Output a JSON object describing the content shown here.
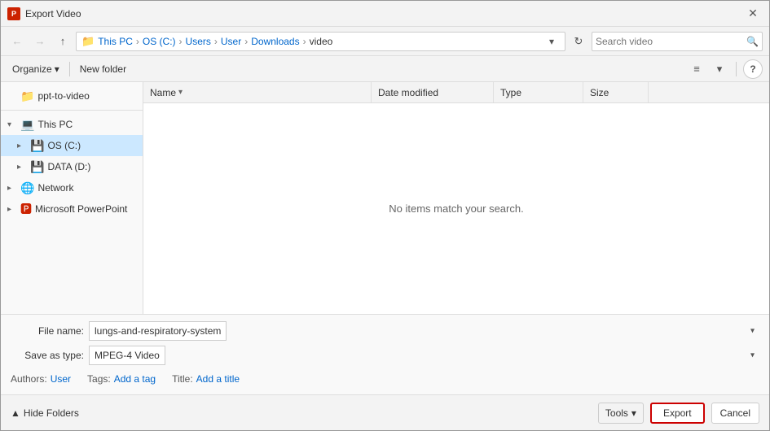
{
  "titleBar": {
    "title": "Export Video",
    "closeLabel": "✕"
  },
  "navBar": {
    "backBtn": "←",
    "forwardBtn": "→",
    "upBtn": "↑",
    "breadcrumb": {
      "folderIcon": "📁",
      "items": [
        "This PC",
        "OS (C:)",
        "Users",
        "User",
        "Downloads",
        "video"
      ]
    },
    "refreshBtn": "↻",
    "searchPlaceholder": "Search video",
    "searchIcon": "🔍"
  },
  "toolbar": {
    "organizeLabel": "Organize",
    "newFolderLabel": "New folder",
    "viewIcon": "≡",
    "viewDropIcon": "▾",
    "helpLabel": "?"
  },
  "sidebar": {
    "items": [
      {
        "id": "ppt-to-video",
        "label": "ppt-to-video",
        "icon": "📁",
        "indent": 0,
        "chevron": ""
      },
      {
        "id": "separator",
        "label": "",
        "icon": "",
        "indent": 0,
        "chevron": ""
      },
      {
        "id": "this-pc",
        "label": "This PC",
        "icon": "💻",
        "indent": 0,
        "chevron": "▾",
        "expanded": true
      },
      {
        "id": "os-c",
        "label": "OS (C:)",
        "icon": "💾",
        "indent": 1,
        "chevron": "▸",
        "selected": true
      },
      {
        "id": "data-d",
        "label": "DATA (D:)",
        "icon": "💾",
        "indent": 1,
        "chevron": "▸"
      },
      {
        "id": "network",
        "label": "Network",
        "icon": "🌐",
        "indent": 0,
        "chevron": "▸"
      },
      {
        "id": "ms-powerpoint",
        "label": "Microsoft PowerPoint",
        "icon": "🅿️",
        "indent": 0,
        "chevron": "▸"
      }
    ]
  },
  "fileList": {
    "columns": [
      {
        "id": "name",
        "label": "Name",
        "sortIcon": "▾"
      },
      {
        "id": "date",
        "label": "Date modified"
      },
      {
        "id": "type",
        "label": "Type"
      },
      {
        "id": "size",
        "label": "Size"
      }
    ],
    "emptyMessage": "No items match your search."
  },
  "bottomBar": {
    "fileNameLabel": "File name:",
    "fileNameValue": "lungs-and-respiratory-system",
    "saveAsTypeLabel": "Save as type:",
    "saveAsTypeValue": "MPEG-4 Video",
    "authorsLabel": "Authors:",
    "authorsValue": "User",
    "tagsLabel": "Tags:",
    "tagsValue": "Add a tag",
    "titleLabel": "Title:",
    "titleValue": "Add a title"
  },
  "actionBar": {
    "hideFoldersLabel": "Hide Folders",
    "chevronDown": "▲",
    "toolsLabel": "Tools",
    "toolsDropIcon": "▾",
    "exportLabel": "Export",
    "cancelLabel": "Cancel"
  }
}
